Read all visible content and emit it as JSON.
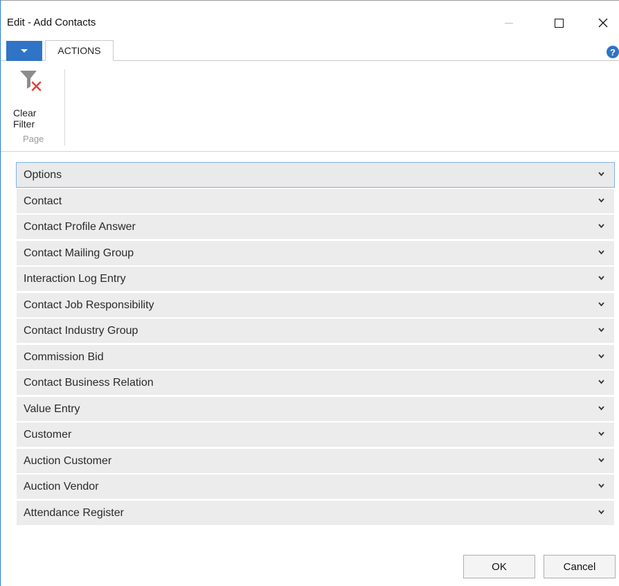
{
  "window": {
    "title": "Edit - Add Contacts",
    "controls": {
      "minimize": "minimize-icon",
      "maximize": "maximize-icon",
      "close": "close-icon"
    }
  },
  "ribbon": {
    "tabs": [
      {
        "label": "ACTIONS",
        "active": true
      }
    ],
    "buttons": [
      {
        "label": "Clear Filter",
        "icon": "clear-filter-icon"
      }
    ],
    "group_label": "Page",
    "help_icon": "help-icon",
    "help_glyph": "?"
  },
  "fasttabs": [
    {
      "label": "Options",
      "selected": true
    },
    {
      "label": "Contact"
    },
    {
      "label": "Contact Profile Answer"
    },
    {
      "label": "Contact Mailing Group"
    },
    {
      "label": "Interaction Log Entry"
    },
    {
      "label": "Contact Job Responsibility"
    },
    {
      "label": "Contact Industry Group"
    },
    {
      "label": "Commission Bid"
    },
    {
      "label": "Contact Business Relation"
    },
    {
      "label": "Value Entry"
    },
    {
      "label": "Customer"
    },
    {
      "label": "Auction Customer"
    },
    {
      "label": "Auction Vendor"
    },
    {
      "label": "Attendance Register"
    }
  ],
  "footer": {
    "ok_label": "OK",
    "cancel_label": "Cancel"
  },
  "colors": {
    "accent": "#2f74c6",
    "tab_bg": "#ececec",
    "selected_outline": "#7fb0e3"
  }
}
